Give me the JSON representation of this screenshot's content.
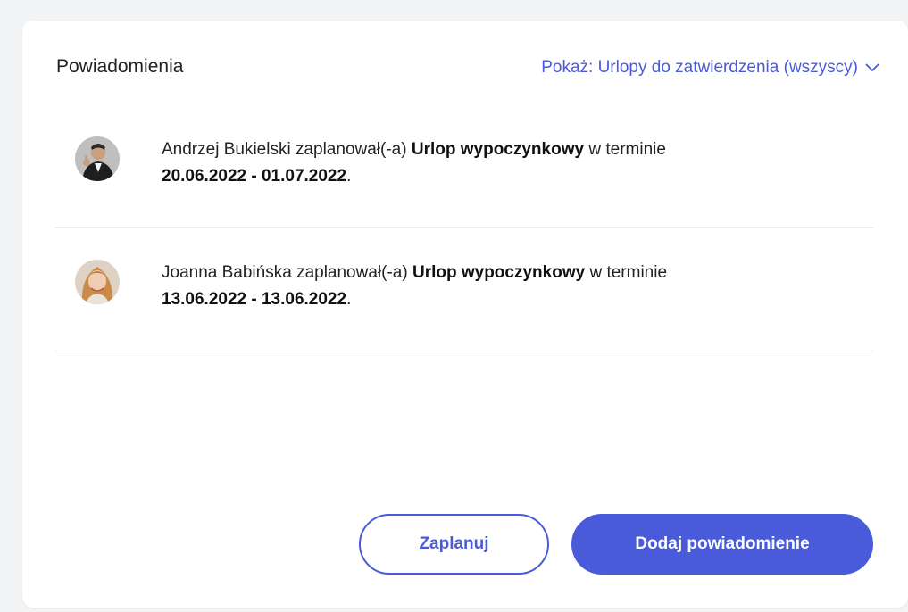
{
  "header": {
    "title": "Powiadomienia",
    "filter_label": "Pokaż: Urlopy do zatwierdzenia (wszyscy)"
  },
  "notifications": [
    {
      "name": "Andrzej Bukielski",
      "verb": "zaplanował(-a)",
      "leave_type": "Urlop wypoczynkowy",
      "in_term": "w terminie",
      "dates": "20.06.2022 - 01.07.2022",
      "end": "."
    },
    {
      "name": "Joanna Babińska",
      "verb": "zaplanował(-a)",
      "leave_type": "Urlop wypoczynkowy",
      "in_term": "w terminie",
      "dates": "13.06.2022 - 13.06.2022",
      "end": "."
    }
  ],
  "actions": {
    "plan_label": "Zaplanuj",
    "add_label": "Dodaj powiadomienie"
  },
  "colors": {
    "accent": "#4a5bd9",
    "text": "#222222",
    "divider": "#ececf0"
  }
}
